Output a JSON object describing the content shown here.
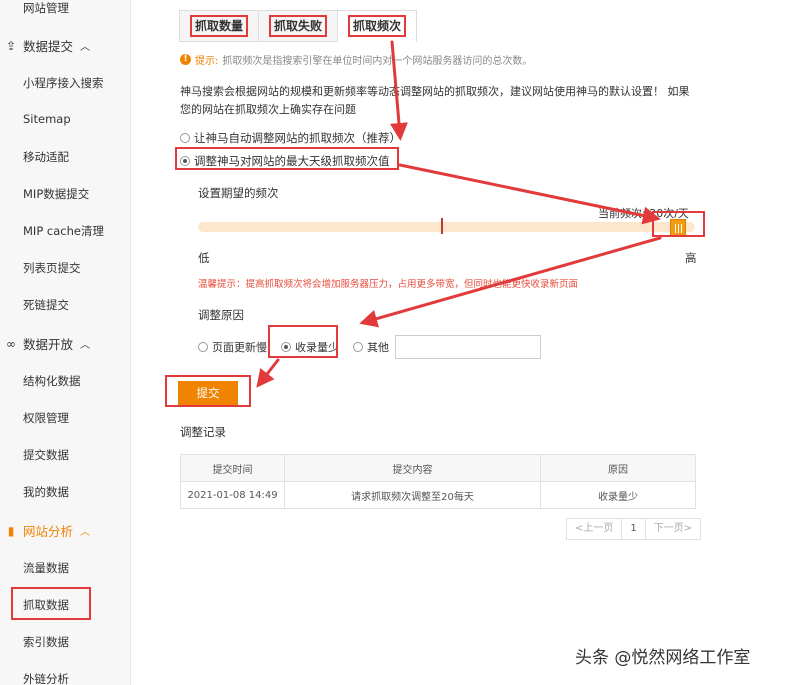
{
  "sidebar": {
    "items": [
      {
        "label": "网站管理",
        "type": "item"
      },
      {
        "label": "数据提交",
        "type": "group",
        "icon": "upload-icon"
      },
      {
        "label": "小程序接入搜索",
        "type": "item"
      },
      {
        "label": "Sitemap",
        "type": "item"
      },
      {
        "label": "移动适配",
        "type": "item"
      },
      {
        "label": "MIP数据提交",
        "type": "item"
      },
      {
        "label": "MIP cache清理",
        "type": "item"
      },
      {
        "label": "列表页提交",
        "type": "item"
      },
      {
        "label": "死链提交",
        "type": "item"
      },
      {
        "label": "数据开放",
        "type": "group",
        "icon": "link-icon"
      },
      {
        "label": "结构化数据",
        "type": "item"
      },
      {
        "label": "权限管理",
        "type": "item"
      },
      {
        "label": "提交数据",
        "type": "item"
      },
      {
        "label": "我的数据",
        "type": "item"
      },
      {
        "label": "网站分析",
        "type": "group",
        "icon": "bar-chart-icon"
      },
      {
        "label": "流量数据",
        "type": "item"
      },
      {
        "label": "抓取数据",
        "type": "item"
      },
      {
        "label": "索引数据",
        "type": "item"
      },
      {
        "label": "外链分析",
        "type": "item"
      }
    ]
  },
  "tabs": [
    "抓取数量",
    "抓取失败",
    "抓取频次"
  ],
  "tip": {
    "head": "提示:",
    "text": "抓取频次是指搜索引擎在单位时间内对一个网站服务器访问的总次数。"
  },
  "description": "神马搜索会根据网站的规模和更新频率等动态调整网站的抓取频次，建议网站使用神马的默认设置！ 如果您的网站在抓取频次上确实存在问题",
  "radio_auto": "让神马自动调整网站的抓取频次（推荐）",
  "radio_manual": "调整神马对网站的最大天级抓取频次值",
  "freq_label": "设置期望的频次",
  "current_freq": "当前频次: 20次/天",
  "slider_low": "低",
  "slider_high": "高",
  "warning": "温馨提示：提高抓取频次将会增加服务器压力，占用更多带宽，但同时也能更快收录新页面",
  "reason_label": "调整原因",
  "reasons": [
    "页面更新慢",
    "收录量少",
    "其他"
  ],
  "submit_label": "提交",
  "record_title": "调整记录",
  "table": {
    "headers": [
      "提交时间",
      "提交内容",
      "原因"
    ],
    "rows": [
      [
        "2021-01-08 14:49",
        "请求抓取频次调整至20每天",
        "收录量少"
      ]
    ]
  },
  "pager": {
    "prev": "<上一页",
    "current": "1",
    "next": "下一页>"
  },
  "watermark": "头条 @悦然网络工作室",
  "colors": {
    "accent": "#f08300",
    "highlight": "#e23a3a"
  }
}
